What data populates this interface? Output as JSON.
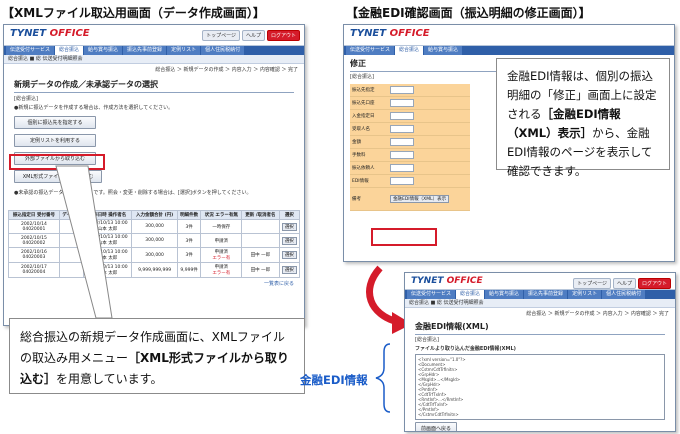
{
  "captions": {
    "left": "【XMLファイル取込用画面（データ作成画面）】",
    "right": "【金融EDI確認画面（振込明細の修正画面）】"
  },
  "app": {
    "logo_main": "TYNET",
    "logo_sub": "OFFICE",
    "top_buttons": [
      "トップページ",
      "ヘルプ",
      "ログアウト"
    ]
  },
  "screen_left": {
    "nav_tabs": [
      "伝送受付サービス",
      "総合振込",
      "給与賞与振込",
      "振込先事前登録",
      "定例リスト",
      "個人住民税納付"
    ],
    "subnav": "総合振込  ■ 総  伝送受付明細照会",
    "breadcrumb": "総合振込 ＞ 新規データの作成 ＞ 内容入力 ＞ 内容確認 ＞ 完了",
    "title": "新規データの作成／未承認データの選択",
    "subtitle": "[総合振込]",
    "note1": "●新規に振込データを作成する場合は、作成方法を選択してください。",
    "buttons": [
      "個別に振込先を指定する",
      "定例リストを利用する",
      "外部ファイルから取り込む",
      "XML形式ファイルから取り込む"
    ],
    "note2": "●未承認の振込データは下記の通りです。照会・変更・削除する場合は、[選択]ボタンを押してください。",
    "table_headers": [
      "振込指定日 受付番号",
      "データ名",
      "操作日時 操作者名",
      "入力金額合計 (円)",
      "明細件数",
      "状況 エラー有無",
      "更新 /取消者名",
      "選択"
    ],
    "rows": [
      {
        "date": "2002/10/14",
        "no": "04020001",
        "name": "",
        "op": "2002/10/13 10:00",
        "user": "山本 太郎",
        "amount": "300,000",
        "count": "3件",
        "status": "一時保存",
        "err": "",
        "upd": "",
        "sel": "選択"
      },
      {
        "date": "2002/10/15",
        "no": "04020002",
        "name": "",
        "op": "2002/10/13 10:00",
        "user": "山本 太郎",
        "amount": "300,000",
        "count": "3件",
        "status": "申請済",
        "err": "",
        "upd": "",
        "sel": "選択"
      },
      {
        "date": "2002/10/16",
        "no": "04020003",
        "name": "",
        "op": "2002/10/13 10:00",
        "user": "山本 太郎",
        "amount": "300,000",
        "count": "3件",
        "status": "申請済",
        "err": "エラー有",
        "upd": "田中 一郎",
        "sel": "選択"
      },
      {
        "date": "2002/10/17",
        "no": "04020004",
        "name": "",
        "op": "2002/10/13 10:00",
        "user": "山本 太郎",
        "amount": "9,999,999,999",
        "count": "9,999件",
        "status": "申請済",
        "err": "エラー有",
        "upd": "田中 一郎",
        "sel": "選択"
      }
    ],
    "footer_link": "一覧表に戻る"
  },
  "screen_right_top": {
    "title": "修正",
    "subtitle": "[総合振込]",
    "form_labels": [
      "振込先指定",
      "振込先口座",
      "入金指定日",
      "受取人名",
      "金額",
      "手数料",
      "振込依頼人",
      "EDI情報",
      "備考"
    ],
    "edi_button": "金融EDI情報（XML）表示"
  },
  "screen_right_bottom": {
    "breadcrumb": "総合振込 ＞ 新規データの作成 ＞ 内容入力 ＞ 内容確認 ＞ 完了",
    "title": "金融EDI情報(XML)",
    "subtitle": "[総合振込]",
    "section": "ファイルより取り込んだ金融EDI情報(XML)",
    "xml_lines": [
      "<?xml version=\"1.0\"?>",
      "<Document>",
      "  <CstmrCdtTrfInitn>",
      "    <GrpHdr>",
      "      <MsgId>...</MsgId>",
      "    </GrpHdr>",
      "    <PmtInf>",
      "      <CdtTrfTxInf>",
      "        <RmtInf>...</RmtInf>",
      "      </CdtTrfTxInf>",
      "    </PmtInf>",
      "  </CstmrCdtTrfInitn>",
      "</Document>"
    ],
    "back_button": "前画面へ戻る"
  },
  "callouts": {
    "left": "総合振込の新規データ作成画面に、XMLファイルの取込み用メニュー［XML形式ファイルから取り込む］を用意しています。",
    "left_lead": "総合振込の新規データ作成画面に、XMLファイルの取込み用メニュー",
    "left_bold": "［XML形式ファイルから取り込む］",
    "left_tail": "を用意しています。",
    "right_lead": "金融EDI情報は、個別の振込明細の「修正」画面上に設定される",
    "right_bold": "［金融EDI情報（XML）表示］",
    "right_tail": "から、金融EDI情報のページを表示して確認できます。"
  },
  "edi_label": "金融EDI情報",
  "colors": {
    "accent": "#d51b2a",
    "nav": "#2f5fa8",
    "form": "#fbd49a",
    "edi_label": "#1a5cc8"
  }
}
